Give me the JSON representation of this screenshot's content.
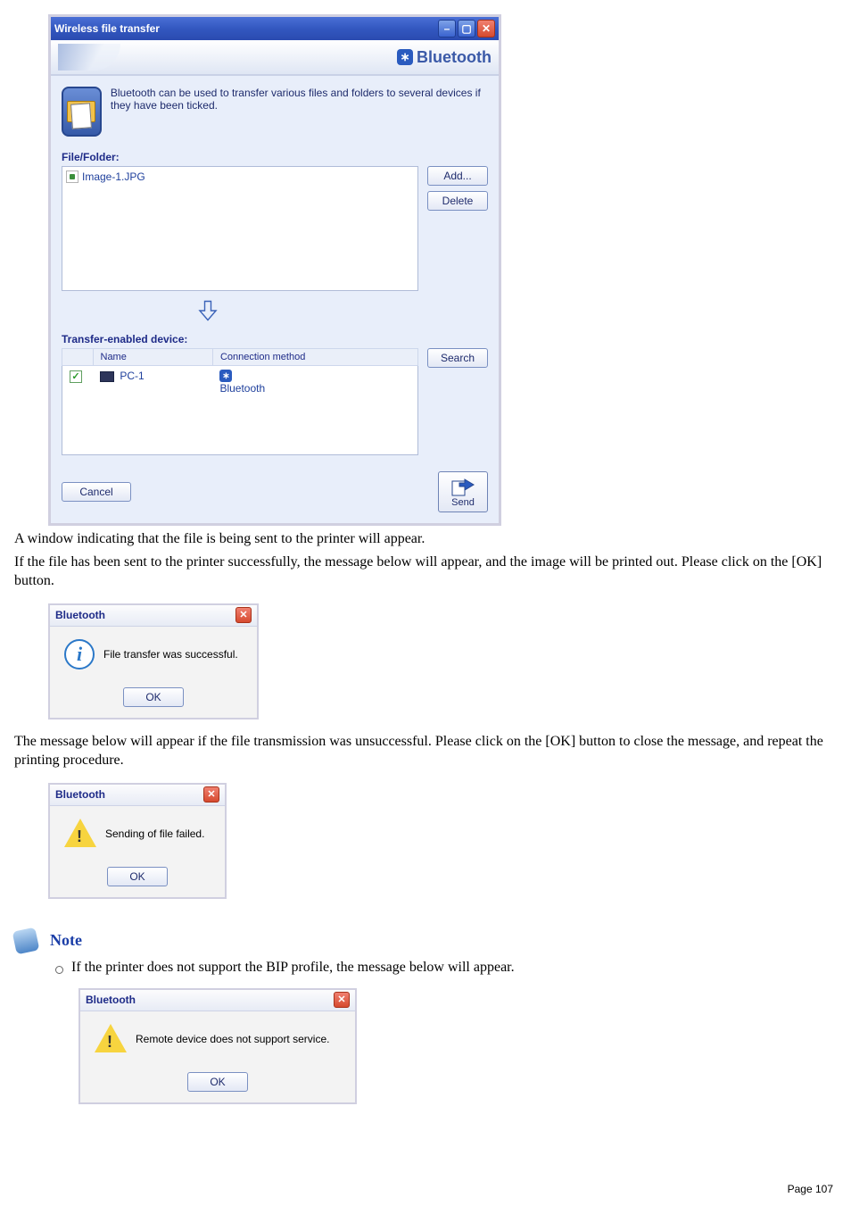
{
  "main_window": {
    "title": "Wireless file transfer",
    "brand": "Bluetooth",
    "info_text": "Bluetooth can be used to transfer various files and folders to several devices if they have been ticked.",
    "file_label": "File/Folder:",
    "files": [
      "Image-1.JPG"
    ],
    "add_btn": "Add...",
    "delete_btn": "Delete",
    "device_label": "Transfer-enabled device:",
    "cols": {
      "name": "Name",
      "conn": "Connection method"
    },
    "devices": [
      {
        "checked": true,
        "name": "PC-1",
        "method": "Bluetooth"
      }
    ],
    "search_btn": "Search",
    "cancel_btn": "Cancel",
    "send_btn": "Send"
  },
  "para1": "A window indicating that the file is being sent to the printer will appear.",
  "para2": "If the file has been sent to the printer successfully, the message below will appear, and the image will be printed out. Please click on the [OK] button.",
  "dlg_success": {
    "title": "Bluetooth",
    "msg": "File transfer was successful.",
    "ok": "OK"
  },
  "para3": "The message below will appear if the file transmission was unsuccessful. Please click on the [OK] button to close the message, and repeat the printing procedure.",
  "dlg_fail": {
    "title": "Bluetooth",
    "msg": "Sending of file failed.",
    "ok": "OK"
  },
  "note_label": "Note",
  "note_item": "If the printer does not support the BIP profile, the message below will appear.",
  "dlg_nosupport": {
    "title": "Bluetooth",
    "msg": "Remote device does not support service.",
    "ok": "OK"
  },
  "page_number": "Page 107"
}
